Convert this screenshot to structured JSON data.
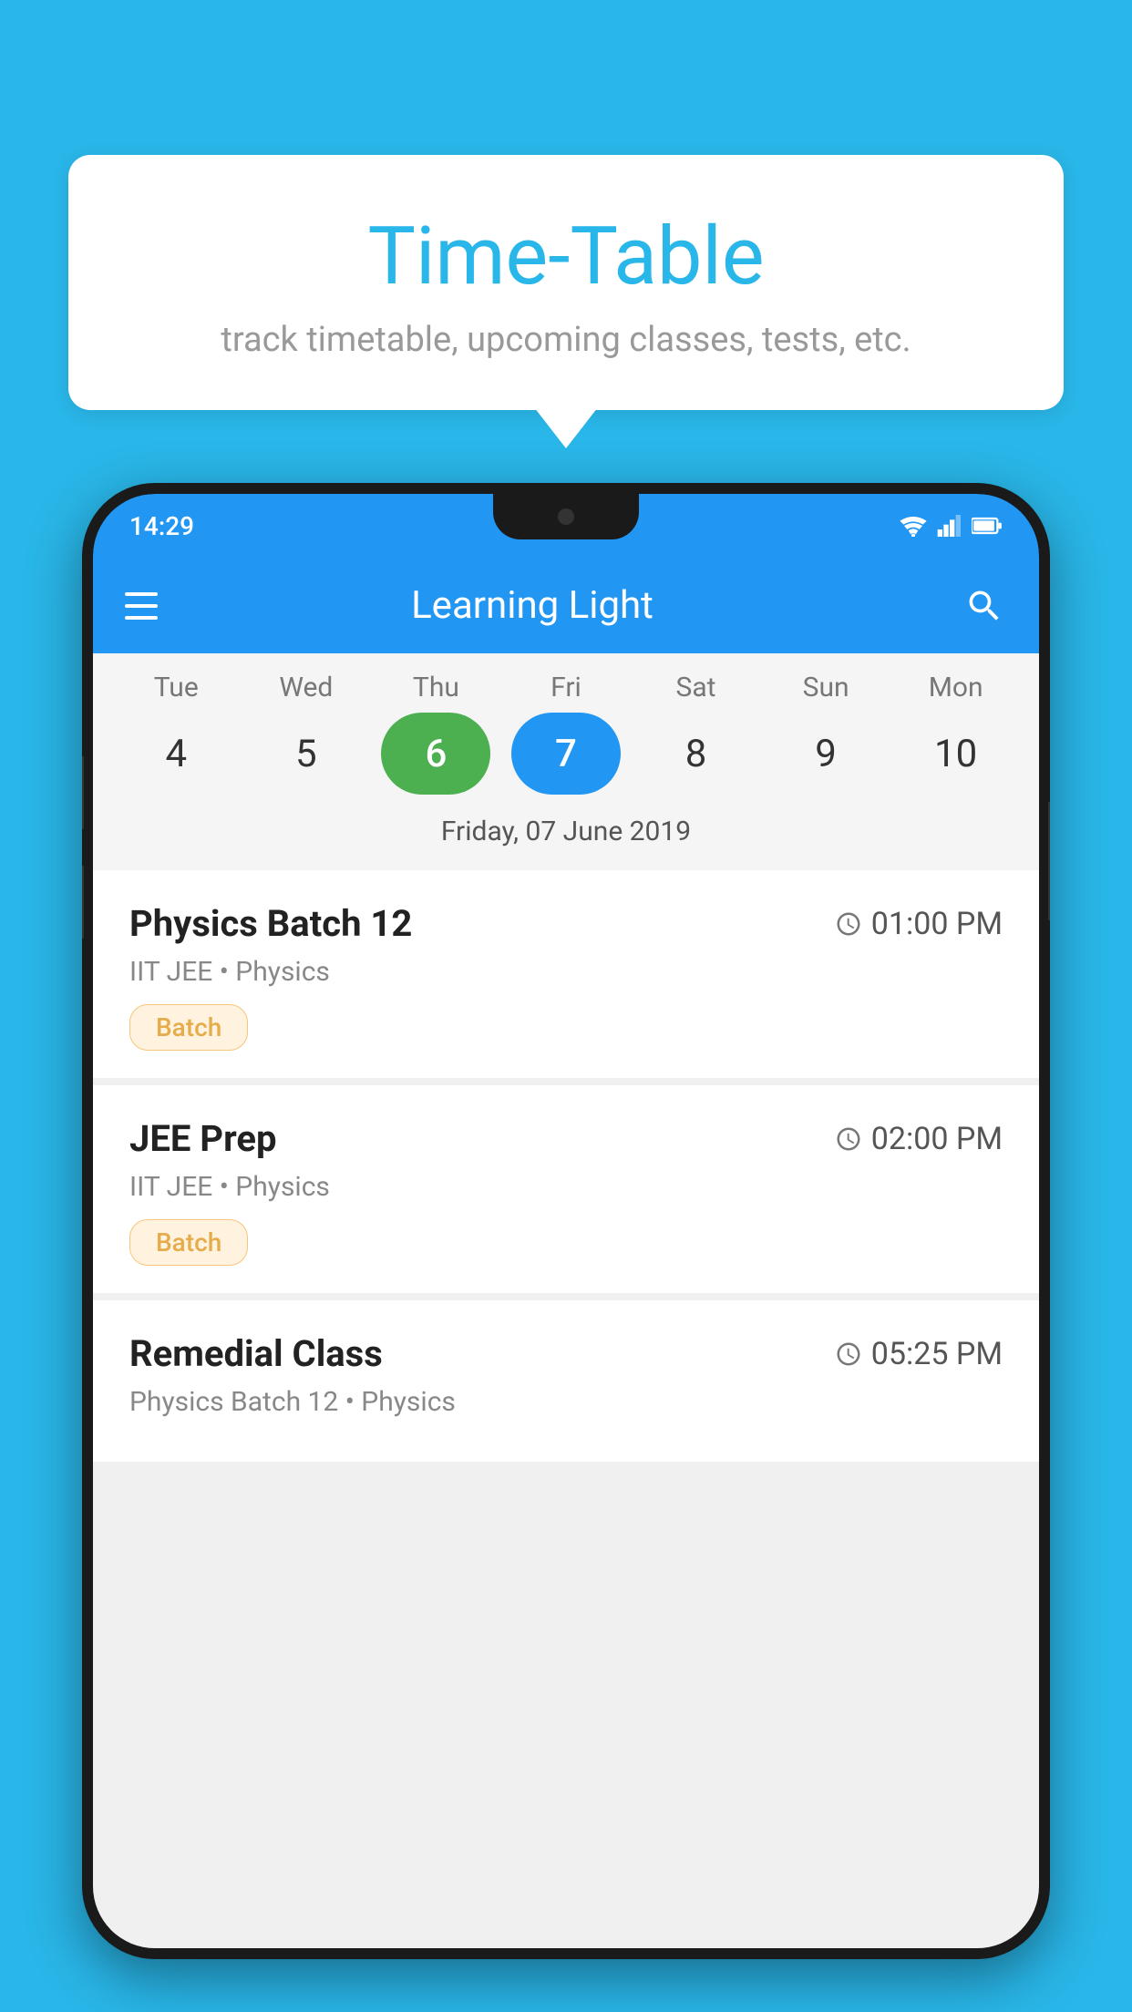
{
  "background_color": "#29b6e8",
  "bubble": {
    "title": "Time-Table",
    "subtitle": "track timetable, upcoming classes, tests, etc."
  },
  "phone": {
    "status_bar": {
      "time": "14:29"
    },
    "app_bar": {
      "title": "Learning Light",
      "menu_icon": "hamburger-icon",
      "search_icon": "search-icon"
    },
    "calendar": {
      "days": [
        {
          "label": "Tue",
          "number": "4",
          "state": "normal"
        },
        {
          "label": "Wed",
          "number": "5",
          "state": "normal"
        },
        {
          "label": "Thu",
          "number": "6",
          "state": "today"
        },
        {
          "label": "Fri",
          "number": "7",
          "state": "selected"
        },
        {
          "label": "Sat",
          "number": "8",
          "state": "normal"
        },
        {
          "label": "Sun",
          "number": "9",
          "state": "normal"
        },
        {
          "label": "Mon",
          "number": "10",
          "state": "normal"
        }
      ],
      "selected_date_label": "Friday, 07 June 2019"
    },
    "classes": [
      {
        "name": "Physics Batch 12",
        "time": "01:00 PM",
        "meta": "IIT JEE • Physics",
        "badge": "Batch"
      },
      {
        "name": "JEE Prep",
        "time": "02:00 PM",
        "meta": "IIT JEE • Physics",
        "badge": "Batch"
      },
      {
        "name": "Remedial Class",
        "time": "05:25 PM",
        "meta": "Physics Batch 12 • Physics",
        "badge": null
      }
    ]
  }
}
